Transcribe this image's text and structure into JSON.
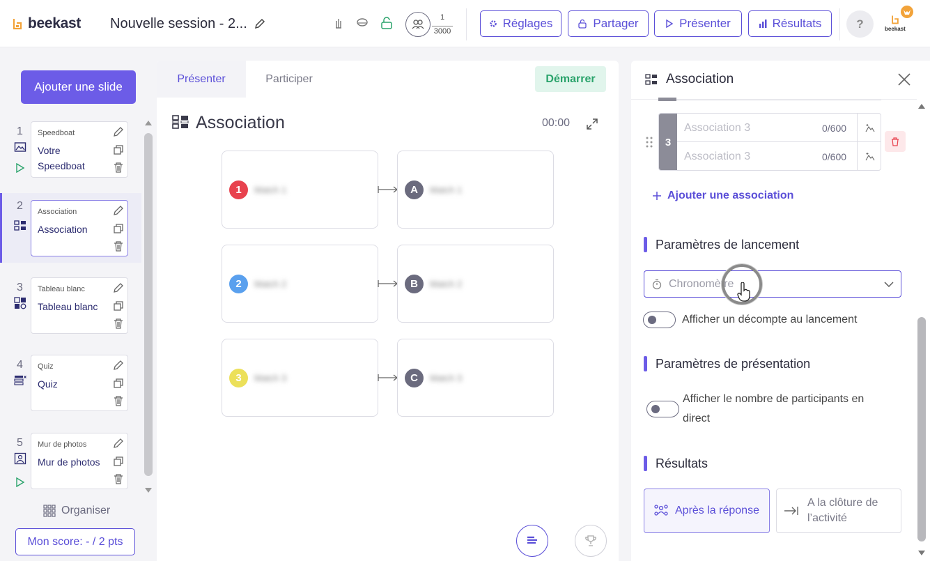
{
  "header": {
    "brand": "beekast",
    "session_title": "Nouvelle session - 2...",
    "participants": {
      "current": "1",
      "max": "3000"
    },
    "buttons": {
      "settings": "Réglages",
      "share": "Partager",
      "present": "Présenter",
      "results": "Résultats"
    },
    "help": "?",
    "avatar_brand": "beekast"
  },
  "sidebar": {
    "add_slide": "Ajouter une slide",
    "slides": [
      {
        "number": "1",
        "type": "Speedboat",
        "title": "Votre Speedboat",
        "icon": "image-icon",
        "playing": true
      },
      {
        "number": "2",
        "type": "Association",
        "title": "Association",
        "icon": "association-icon",
        "playing": false
      },
      {
        "number": "3",
        "type": "Tableau blanc",
        "title": "Tableau blanc",
        "icon": "whiteboard-icon",
        "playing": false
      },
      {
        "number": "4",
        "type": "Quiz",
        "title": "Quiz",
        "icon": "quiz-icon",
        "playing": false
      },
      {
        "number": "5",
        "type": "Mur de photos",
        "title": "Mur de photos",
        "icon": "photo-wall-icon",
        "playing": true
      }
    ],
    "organise": "Organiser",
    "score": "Mon score: - / 2 pts"
  },
  "center": {
    "tabs": [
      "Présenter",
      "Participer"
    ],
    "start": "Démarrer",
    "activity_title": "Association",
    "timer": "00:00",
    "pairs": [
      {
        "left_badge": "1",
        "left_color": "#e8424e",
        "left_text": "Match 1",
        "right_badge": "A",
        "right_text": "Match 1"
      },
      {
        "left_badge": "2",
        "left_color": "#5aa0ee",
        "left_text": "Match 2",
        "right_badge": "B",
        "right_text": "Match 2"
      },
      {
        "left_badge": "3",
        "left_color": "#ece05a",
        "left_text": "Match 3",
        "right_badge": "C",
        "right_text": "Match 3"
      }
    ]
  },
  "panel": {
    "title": "Association",
    "association": {
      "number": "3",
      "rows": [
        {
          "placeholder": "Association 3",
          "count": "0/600"
        },
        {
          "placeholder": "Association 3",
          "count": "0/600"
        }
      ]
    },
    "add_association": "Ajouter une association",
    "launch_section": "Paramètres de lancement",
    "timer_placeholder": "Chronomètre",
    "countdown_label": "Afficher un décompte au lancement",
    "presentation_section": "Paramètres de présentation",
    "participants_label": "Afficher le nombre de participants en direct",
    "results_section": "Résultats",
    "results_options": [
      "Après la réponse",
      "A la clôture de l’activité"
    ]
  },
  "colors": {
    "accent": "#6c5ce7",
    "success": "#2aa36b",
    "danger": "#e8424e"
  }
}
